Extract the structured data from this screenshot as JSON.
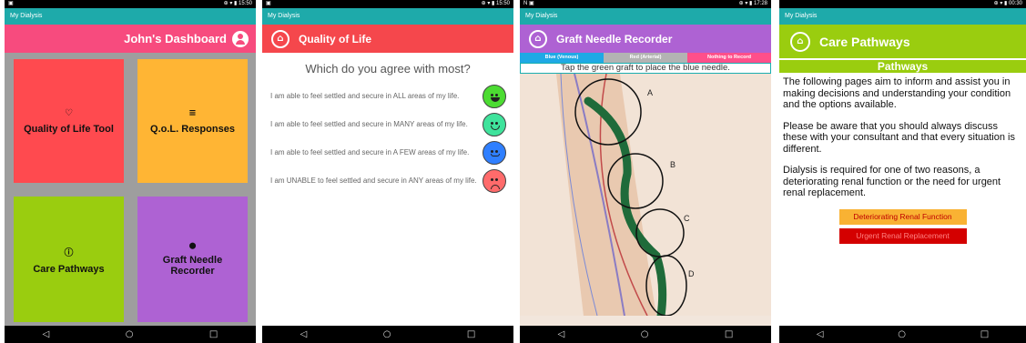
{
  "phone1": {
    "status": {
      "left": "▣",
      "right": "⊕ ▾ ▮ 15:50"
    },
    "app_title": "My Dialysis",
    "header_title": "John's Dashboard",
    "tiles": [
      {
        "label": "Quality of Life Tool",
        "icon": "heart-pulse-icon",
        "glyph": "♡",
        "color": "#ff4a4f"
      },
      {
        "label": "Q.o.L. Responses",
        "icon": "list-icon",
        "glyph": "≡",
        "color": "#ffb534"
      },
      {
        "label": "Care Pathways",
        "icon": "info-icon",
        "glyph": "ⓘ",
        "color": "#9acd0f"
      },
      {
        "label": "Graft Needle Recorder",
        "icon": "map-pin-plus-icon",
        "glyph": "⬤",
        "color": "#ae62d3"
      }
    ]
  },
  "phone2": {
    "status": {
      "left": "▣",
      "right": "⊕ ▾ ▮ 15:50"
    },
    "app_title": "My Dialysis",
    "header_title": "Quality of Life",
    "question": "Which do you agree with most?",
    "options": [
      {
        "text": "I am able to feel settled and secure in ALL areas of my life.",
        "face": "very-happy",
        "color": "#4cdc32"
      },
      {
        "text": "I am able to feel settled and secure in MANY areas of my life.",
        "face": "happy",
        "color": "#3fe39c"
      },
      {
        "text": "I am able to feel settled and secure in A FEW areas of my life.",
        "face": "neutral",
        "color": "#2f7fff"
      },
      {
        "text": "I am UNABLE to feel settled and secure in ANY areas of my life.",
        "face": "sad",
        "color": "#ff6b6b"
      }
    ]
  },
  "phone3": {
    "status": {
      "left": "N ▣",
      "right": "⊕ ▾ ▮ 17:28"
    },
    "app_title": "My Dialysis",
    "header_title": "Graft Needle Recorder",
    "segments": [
      {
        "label": "Blue (Venous)",
        "color": "#1fa9e5"
      },
      {
        "label": "Red (Arterial)",
        "color": "#b3b3b3"
      },
      {
        "label": "Nothing to Record",
        "color": "#ff4f8a"
      }
    ],
    "instruction": "Tap the green graft to place the blue needle.",
    "needle_labels": [
      "A",
      "B",
      "C",
      "D"
    ]
  },
  "phone4": {
    "status": {
      "left": "",
      "right": "⊕ ▾ ▮ 00:30"
    },
    "app_title": "My Dialysis",
    "header_title": "Care Pathways",
    "subheader": "Pathways",
    "paragraphs": [
      "The following pages aim to inform and assist you in making decisions and understanding your condition and the options available.",
      "Please be aware that you should always discuss these with your consultant and that every situation is different.",
      "Dialysis is required for one of two reasons, a deteriorating renal function or the need for urgent renal replacement."
    ],
    "buttons": [
      {
        "label": "Deteriorating Renal Function",
        "bg": "#f9b233",
        "fg": "#c00000"
      },
      {
        "label": "Urgent Renal Replacement",
        "bg": "#d40000",
        "fg": "#ff8080"
      }
    ]
  },
  "navbar": {
    "back": "◁",
    "home": "○",
    "recents": "□"
  }
}
